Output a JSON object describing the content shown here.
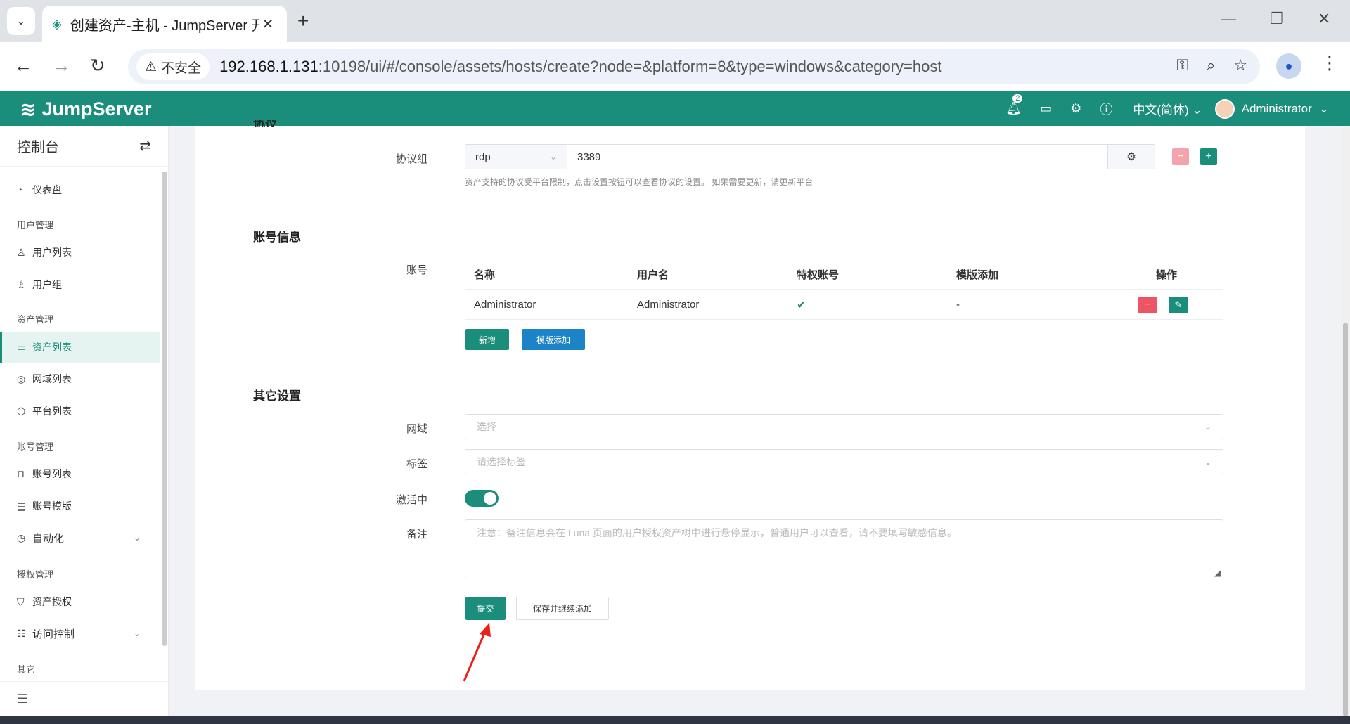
{
  "browser": {
    "tab_title": "创建资产-主机 - JumpServer 开",
    "insecure_label": "不安全",
    "url_host": "192.168.1.131",
    "url_rest": ":10198/ui/#/console/assets/hosts/create?node=&platform=8&type=windows&category=host"
  },
  "topbar": {
    "brand": "JumpServer",
    "notification_count": "2",
    "language": "中文(简体)",
    "username": "Administrator"
  },
  "sidebar": {
    "title": "控制台",
    "dashboard": "仪表盘",
    "group_user": "用户管理",
    "user_list": "用户列表",
    "user_group": "用户组",
    "group_asset": "资产管理",
    "asset_list": "资产列表",
    "domain_list": "网域列表",
    "platform_list": "平台列表",
    "group_account": "账号管理",
    "account_list": "账号列表",
    "account_template": "账号模版",
    "automation": "自动化",
    "group_perm": "授权管理",
    "asset_perm": "资产授权",
    "access_control": "访问控制",
    "group_other": "其它"
  },
  "form": {
    "protocol_section_partial": "协议",
    "protocol_group_label": "协议组",
    "protocol_name": "rdp",
    "protocol_port": "3389",
    "protocol_help": "资产支持的协议受平台限制，点击设置按钮可以查看协议的设置。 如果需要更新，请更新平台",
    "account_section": "账号信息",
    "account_label": "账号",
    "account_table": {
      "headers": [
        "名称",
        "用户名",
        "特权账号",
        "模版添加",
        "操作"
      ],
      "rows": [
        {
          "name": "Administrator",
          "username": "Administrator",
          "privileged": "✔",
          "template": "-"
        }
      ]
    },
    "add_button": "新增",
    "template_add_button": "模版添加",
    "other_section": "其它设置",
    "domain_label": "网域",
    "domain_placeholder": "选择",
    "labels_label": "标签",
    "labels_placeholder": "请选择标签",
    "active_label": "激活中",
    "active": true,
    "comment_label": "备注",
    "comment_placeholder": "注意：备注信息会在 Luna 页面的用户授权资产树中进行悬停显示，普通用户可以查看，请不要填写敏感信息。",
    "submit_button": "提交",
    "save_continue_button": "保存并继续添加"
  },
  "colors": {
    "brand": "#1a8e7a",
    "danger": "#ed5565",
    "info": "#1c84c6"
  }
}
